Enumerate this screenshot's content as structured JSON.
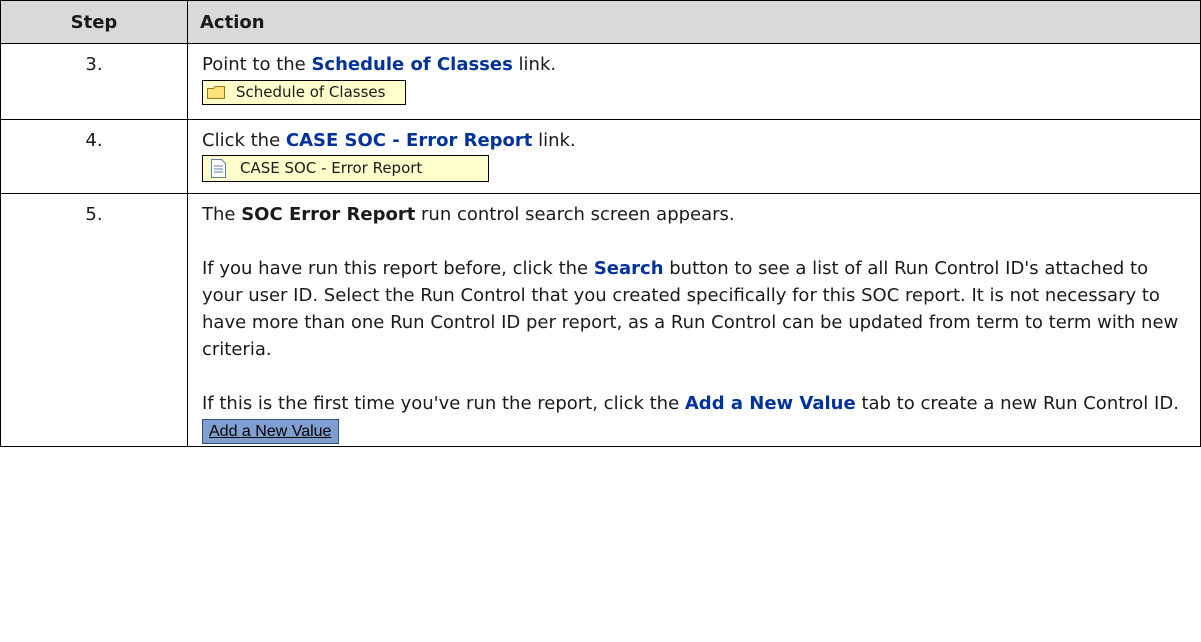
{
  "table": {
    "header": {
      "step": "Step",
      "action": "Action"
    },
    "rows": [
      {
        "step": "3.",
        "pre": "Point to the ",
        "link": "Schedule of Classes",
        "post": " link.",
        "shot_label": "Schedule of Classes",
        "shot_icon": "folder-icon"
      },
      {
        "step": "4.",
        "pre": "Click the ",
        "link": "CASE SOC - Error Report",
        "post": " link.",
        "shot_label": "CASE SOC - Error Report",
        "shot_icon": "document-icon"
      },
      {
        "step": "5.",
        "p1_pre": "The ",
        "p1_bold": "SOC Error Report",
        "p1_post": " run control search screen appears.",
        "p2_pre": "If you have run this report before, click the ",
        "p2_link": "Search",
        "p2_post": " button to see a list of all Run Control ID's attached to your user ID.  Select the Run Control that you created specifically for this SOC report.  It is not necessary to have more than one Run Control ID per report, as a Run Control can be updated from term to term with new criteria.",
        "p3_pre": "If this is the first time you've run the report, click the ",
        "p3_link": "Add a New Value",
        "p3_post": " tab to create a new Run Control ID.",
        "shot_label": "Add a New Value"
      }
    ]
  },
  "colors": {
    "header_bg": "#d9d9d9",
    "link": "#003399",
    "highlight_bg": "#ffffcc",
    "tab_bg": "#7f9fd1"
  }
}
